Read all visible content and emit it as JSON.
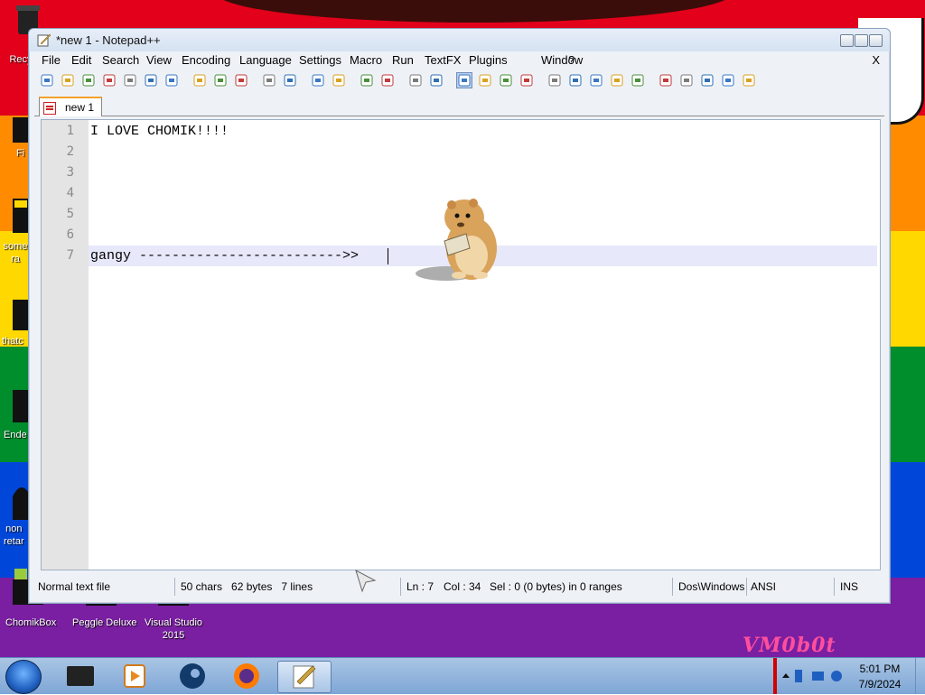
{
  "window": {
    "title": "*new 1 - Notepad++",
    "close_doc_label": "X"
  },
  "menu": [
    "File",
    "Edit",
    "Search",
    "View",
    "Encoding",
    "Language",
    "Settings",
    "Macro",
    "Run",
    "TextFX",
    "Plugins",
    "Window",
    "?"
  ],
  "toolbar_icons": [
    "new-file-icon",
    "open-file-icon",
    "save-icon",
    "save-all-icon",
    "close-icon",
    "close-all-icon",
    "print-icon",
    "cut-icon",
    "copy-icon",
    "paste-icon",
    "undo-icon",
    "redo-icon",
    "find-icon",
    "replace-icon",
    "zoom-in-icon",
    "zoom-out-icon",
    "sync-v-icon",
    "sync-h-icon",
    "word-wrap-icon",
    "show-all-chars-icon",
    "indent-guide-icon",
    "user-define-icon",
    "record-macro-icon",
    "stop-record-icon",
    "play-macro-icon",
    "run-macro-multiple-icon",
    "save-macro-icon",
    "fold-icon",
    "up-icon",
    "down-icon",
    "fold-all-icon",
    "spellcheck-icon"
  ],
  "tab": {
    "label": "new 1"
  },
  "editor": {
    "line_numbers": [
      "1",
      "2",
      "3",
      "4",
      "5",
      "6",
      "7"
    ],
    "lines": [
      "I LOVE CHOMIK!!!!",
      "",
      "",
      "",
      "",
      "",
      "gangy ------------------------->>"
    ]
  },
  "status": {
    "file_type": "Normal text file",
    "counts": "50 chars   62 bytes   7 lines",
    "ln": "Ln : 7",
    "col": "Col : 34",
    "sel": "Sel : 0 (0 bytes) in 0 ranges",
    "eol": "Dos\\Windows",
    "encoding": "ANSI",
    "mode": "INS"
  },
  "desktop_icons": [
    {
      "label": "Recy"
    },
    {
      "label": "Fi"
    },
    {
      "label": "some\nra"
    },
    {
      "label": "thatc"
    },
    {
      "label": "Ende"
    },
    {
      "label": "non\nretar"
    },
    {
      "label": "ChomikBox"
    },
    {
      "label": "Peggle Deluxe"
    },
    {
      "label": "Visual Studio\n2015"
    }
  ],
  "watermark": "VM0b0t",
  "taskbar": {
    "items": [
      "terminal-app-icon",
      "media-player-icon",
      "steam-icon",
      "firefox-icon",
      "notepadpp-icon"
    ],
    "time": "5:01 PM",
    "date": "7/9/2024"
  },
  "colors": {
    "current_line": "#e8e8fb",
    "tab_accent": "#f3a12c",
    "gutter": "#e4e4e4"
  }
}
